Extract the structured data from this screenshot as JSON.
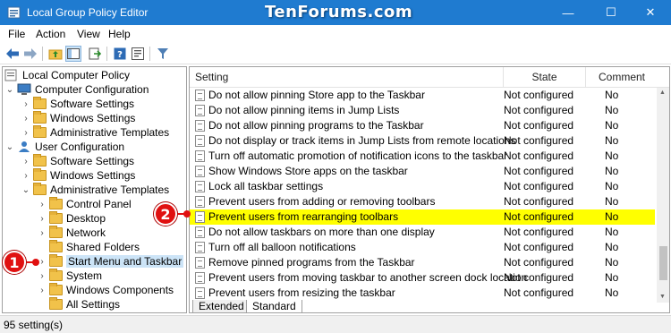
{
  "window": {
    "title": "Local Group Policy Editor",
    "watermark": "TenForums.com",
    "min_glyph": "—",
    "max_glyph": "☐",
    "close_glyph": "✕"
  },
  "menu": [
    "File",
    "Action",
    "View",
    "Help"
  ],
  "toolbar_icons": [
    "back-arrow-icon",
    "forward-arrow-icon",
    "up-folder-icon",
    "show-hide-tree-icon",
    "export-list-icon",
    "help-icon",
    "properties-icon",
    "filter-icon"
  ],
  "tree": {
    "root": "Local Computer Policy",
    "computer_config": "Computer Configuration",
    "cc_software": "Software Settings",
    "cc_windows": "Windows Settings",
    "cc_admin": "Administrative Templates",
    "user_config": "User Configuration",
    "uc_software": "Software Settings",
    "uc_windows": "Windows Settings",
    "uc_admin": "Administrative Templates",
    "control_panel": "Control Panel",
    "desktop": "Desktop",
    "network": "Network",
    "shared_folders": "Shared Folders",
    "start_menu": "Start Menu and Taskbar",
    "system": "System",
    "windows_components": "Windows Components",
    "all_settings": "All Settings"
  },
  "columns": {
    "setting": "Setting",
    "state": "State",
    "comment": "Comment"
  },
  "rows": [
    {
      "setting": "Do not allow pinning Store app to the Taskbar",
      "state": "Not configured",
      "comment": "No"
    },
    {
      "setting": "Do not allow pinning items in Jump Lists",
      "state": "Not configured",
      "comment": "No"
    },
    {
      "setting": "Do not allow pinning programs to the Taskbar",
      "state": "Not configured",
      "comment": "No"
    },
    {
      "setting": "Do not display or track items in Jump Lists from remote locations",
      "state": "Not configured",
      "comment": "No"
    },
    {
      "setting": "Turn off automatic promotion of notification icons to the taskbar",
      "state": "Not configured",
      "comment": "No"
    },
    {
      "setting": "Show Windows Store apps on the taskbar",
      "state": "Not configured",
      "comment": "No"
    },
    {
      "setting": "Lock all taskbar settings",
      "state": "Not configured",
      "comment": "No"
    },
    {
      "setting": "Prevent users from adding or removing toolbars",
      "state": "Not configured",
      "comment": "No"
    },
    {
      "setting": "Prevent users from rearranging toolbars",
      "state": "Not configured",
      "comment": "No"
    },
    {
      "setting": "Do not allow taskbars on more than one display",
      "state": "Not configured",
      "comment": "No"
    },
    {
      "setting": "Turn off all balloon notifications",
      "state": "Not configured",
      "comment": "No"
    },
    {
      "setting": "Remove pinned programs from the Taskbar",
      "state": "Not configured",
      "comment": "No"
    },
    {
      "setting": "Prevent users from moving taskbar to another screen dock location",
      "state": "Not configured",
      "comment": "No"
    },
    {
      "setting": "Prevent users from resizing the taskbar",
      "state": "Not configured",
      "comment": "No"
    }
  ],
  "tabs": {
    "extended": "Extended",
    "standard": "Standard"
  },
  "status": "95 setting(s)",
  "callouts": {
    "one": "1",
    "two": "2"
  },
  "colors": {
    "titlebar": "#1f7bd0",
    "highlight": "#ffff00",
    "callout": "#e01010"
  }
}
